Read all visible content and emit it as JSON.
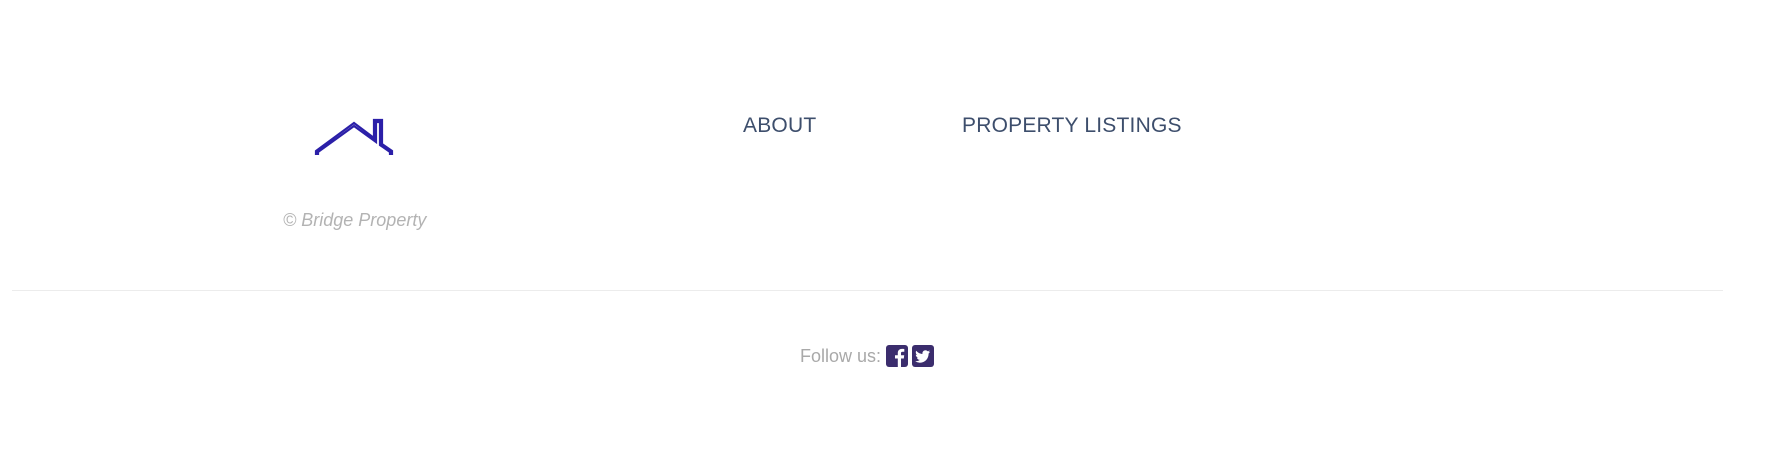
{
  "brand": {
    "logo_icon": "house-roof-icon",
    "copyright": "© Bridge Property",
    "logo_color": "#2b1fa8"
  },
  "nav": {
    "items": [
      {
        "label": "ABOUT"
      },
      {
        "label": "PROPERTY LISTINGS"
      }
    ],
    "link_color": "#3d4e6c"
  },
  "social": {
    "label": "Follow us:",
    "icons": [
      "facebook-square-icon",
      "twitter-square-icon"
    ],
    "icon_color": "#3b2d6d"
  }
}
